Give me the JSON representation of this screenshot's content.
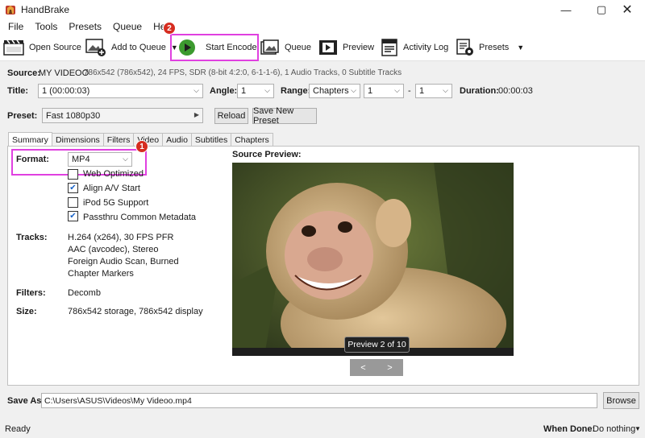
{
  "window": {
    "title": "HandBrake"
  },
  "menu": [
    "File",
    "Tools",
    "Presets",
    "Queue",
    "Help"
  ],
  "toolbar": {
    "open_source": "Open Source",
    "add_to_queue": "Add to Queue",
    "start_encode": "Start Encode",
    "queue": "Queue",
    "preview": "Preview",
    "activity_log": "Activity Log",
    "presets": "Presets"
  },
  "annotations": {
    "badge_start": "2",
    "badge_format": "1",
    "highlight_color": "#e040e0"
  },
  "source": {
    "label": "Source:",
    "name": "MY VIDEOO",
    "details": "786x542 (786x542), 24 FPS, SDR (8-bit 4:2:0, 6-1-1-6), 1 Audio Tracks, 0 Subtitle Tracks"
  },
  "title_row": {
    "title_label": "Title:",
    "title_value": "1 (00:00:03)",
    "angle_label": "Angle:",
    "angle_value": "1",
    "range_label": "Range:",
    "range_value": "Chapters",
    "range_start": "1",
    "range_sep": "-",
    "range_end": "1",
    "duration_label": "Duration:",
    "duration_value": "00:00:03"
  },
  "preset_row": {
    "label": "Preset:",
    "value": "Fast 1080p30",
    "reload": "Reload",
    "save_new": "Save New Preset"
  },
  "tabs": [
    "Summary",
    "Dimensions",
    "Filters",
    "Video",
    "Audio",
    "Subtitles",
    "Chapters"
  ],
  "summary": {
    "format_label": "Format:",
    "format_value": "MP4",
    "web_optimized": "Web Optimized",
    "align_av": "Align A/V Start",
    "ipod": "iPod 5G Support",
    "passthru": "Passthru Common Metadata",
    "tracks_label": "Tracks:",
    "tracks": [
      "H.264 (x264), 30 FPS PFR",
      "AAC (avcodec), Stereo",
      "Foreign Audio Scan, Burned",
      "Chapter Markers"
    ],
    "filters_label": "Filters:",
    "filters_value": "Decomb",
    "size_label": "Size:",
    "size_value": "786x542 storage, 786x542 display"
  },
  "preview": {
    "title": "Source Preview:",
    "caption": "Preview 2 of 10",
    "prev": "<",
    "next": ">"
  },
  "save": {
    "label": "Save As:",
    "path": "C:\\Users\\ASUS\\Videos\\My Videoo.mp4",
    "browse": "Browse"
  },
  "status": {
    "text": "Ready",
    "when_done_label": "When Done:",
    "when_done_value": "Do nothing"
  }
}
